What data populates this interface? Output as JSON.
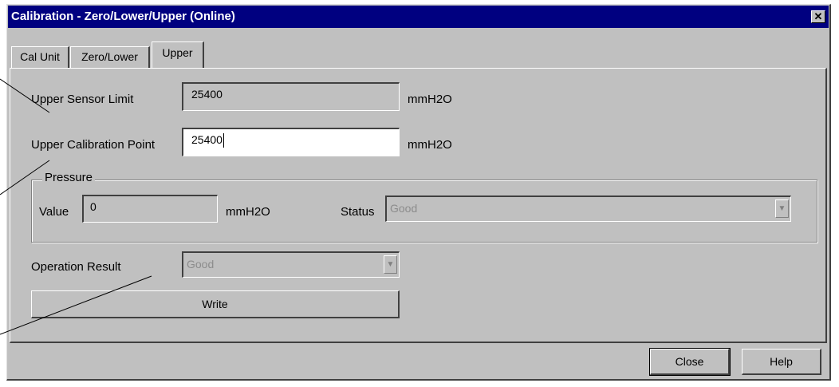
{
  "window": {
    "title": "Calibration - Zero/Lower/Upper  (Online)",
    "close_glyph": "✕"
  },
  "tabs": [
    {
      "label": "Cal Unit",
      "active": false
    },
    {
      "label": "Zero/Lower",
      "active": false
    },
    {
      "label": "Upper",
      "active": true
    }
  ],
  "upper_sensor_limit": {
    "label": "Upper Sensor Limit",
    "value": "25400",
    "unit": "mmH2O"
  },
  "upper_calibration_point": {
    "label": "Upper Calibration Point",
    "value": "25400",
    "unit": "mmH2O"
  },
  "pressure": {
    "group_label": "Pressure",
    "value_label": "Value",
    "value": "0",
    "unit": "mmH2O",
    "status_label": "Status",
    "status_value": "Good"
  },
  "operation_result": {
    "label": "Operation Result",
    "value": "Good"
  },
  "buttons": {
    "write": "Write",
    "close": "Close",
    "help": "Help"
  },
  "icons": {
    "combo_arrow": "▼"
  }
}
